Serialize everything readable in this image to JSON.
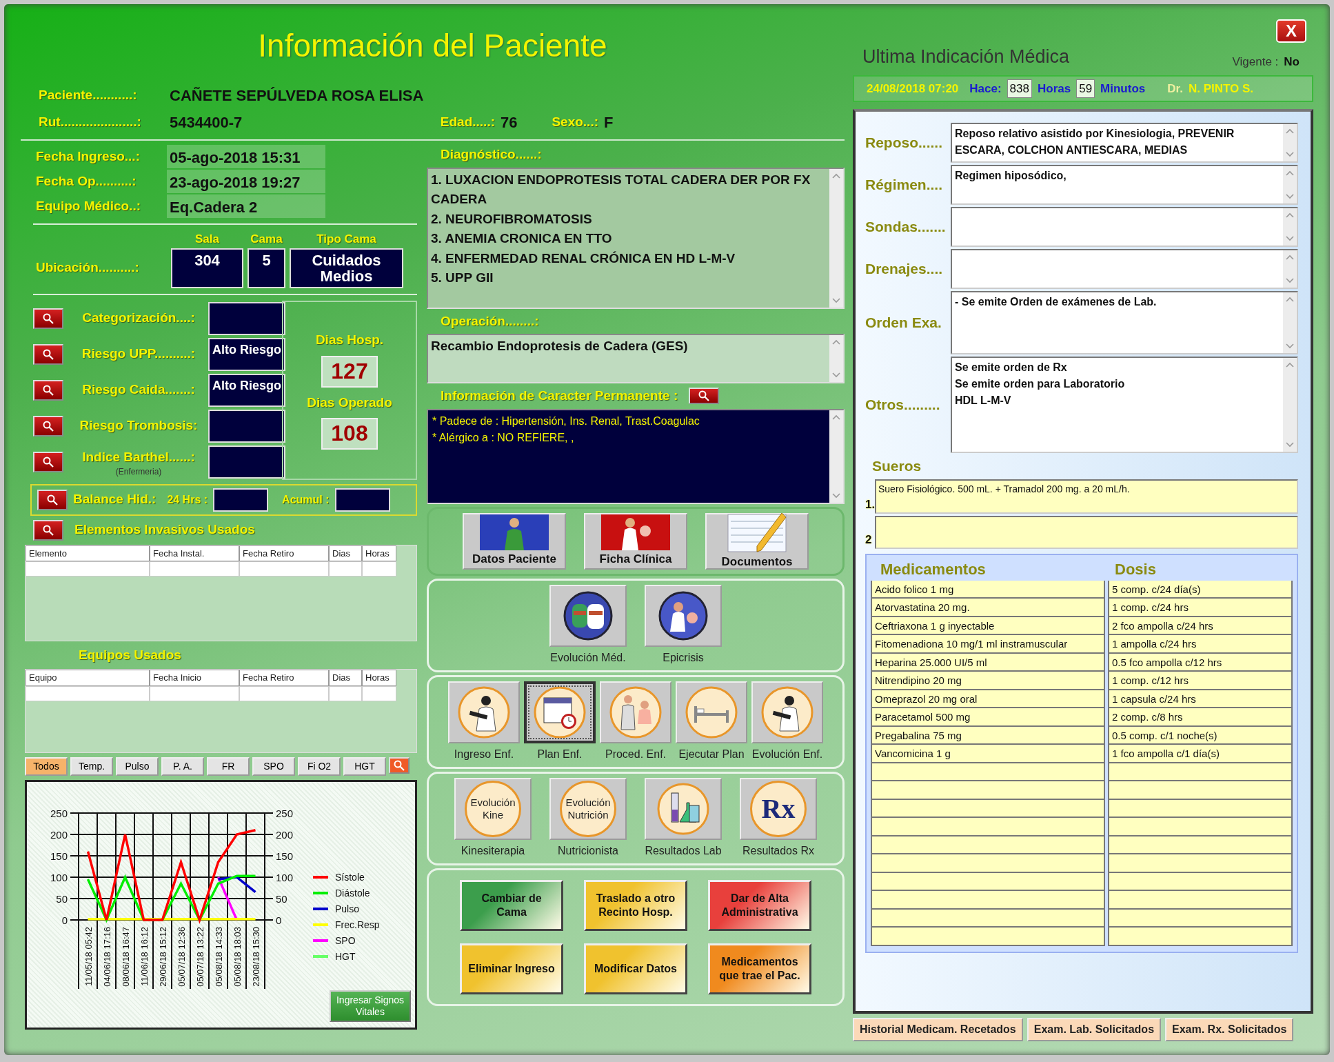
{
  "window": {
    "title": "Información del Paciente",
    "close_button": "X"
  },
  "patient": [
    {
      "label": "Paciente...........:",
      "value": "CAÑETE SEPÚLVEDA ROSA ELISA"
    },
    {
      "label": "Rut.....................:",
      "value": "5434400-7"
    }
  ],
  "age": {
    "label": "Edad.....:",
    "value": "76"
  },
  "sex": {
    "label": "Sexo...:",
    "value": "F"
  },
  "admission": [
    {
      "label": "Fecha Ingreso...:",
      "value": "05-ago-2018 15:31"
    },
    {
      "label": "Fecha Op..........:",
      "value": "23-ago-2018 19:27"
    },
    {
      "label": "Equipo Médico..:",
      "value": "Eq.Cadera 2"
    }
  ],
  "location": {
    "label": "Ubicación..........:",
    "fields": [
      {
        "label": "Sala",
        "value": "304"
      },
      {
        "label": "Cama",
        "value": "5"
      },
      {
        "label": "Tipo Cama",
        "value": "Cuidados Medios"
      }
    ]
  },
  "risks": [
    {
      "label": "Categorización....:"
    },
    {
      "label": "Riesgo UPP..........:",
      "value": "Alto Riesgo"
    },
    {
      "label": "Riesgo Caida.......:",
      "value": "Alto Riesgo"
    },
    {
      "label": "Riesgo Trombosis:"
    },
    {
      "label": "Indice Barthel......:",
      "sublabel": "(Enfermeria)"
    }
  ],
  "stay": [
    {
      "label": "Dias Hosp.",
      "value": "127"
    },
    {
      "label": "Dias Operado",
      "value": "108"
    }
  ],
  "fluid_balance": {
    "label": "Balance Hid.:",
    "fields": [
      "24 Hrs :",
      "Acumul :"
    ]
  },
  "invasive_elements": {
    "title": "Elementos Invasivos Usados",
    "columns": [
      "Elemento",
      "Fecha Instal.",
      "Fecha Retiro",
      "Dias",
      "Horas"
    ]
  },
  "equipment": {
    "title": "Equipos Usados",
    "columns": [
      "Equipo",
      "Fecha Inicio",
      "Fecha Retiro",
      "Dias",
      "Horas"
    ]
  },
  "vitals": {
    "tabs": [
      {
        "label": "Todos",
        "selected": true
      },
      {
        "label": "Temp.",
        "selected": false
      },
      {
        "label": "Pulso",
        "selected": false
      },
      {
        "label": "P. A.",
        "selected": false
      },
      {
        "label": "FR",
        "selected": false
      },
      {
        "label": "SPO",
        "selected": false
      },
      {
        "label": "Fi O2",
        "selected": false
      },
      {
        "label": "HGT",
        "selected": false
      }
    ],
    "chart_data": {
      "type": "line",
      "categories": [
        "11/05/18 05:42",
        "04/06/18 17:16",
        "08/06/18 16:47",
        "11/06/18 16:12",
        "29/06/18 15:12",
        "05/07/18 12:36",
        "05/07/18 13:22",
        "05/08/18 14:33",
        "05/08/18 18:03",
        "23/08/18 15:30"
      ],
      "ylim": [
        0,
        250
      ],
      "yticks": [
        0,
        50,
        100,
        150,
        200,
        250
      ],
      "annotations": [
        "0",
        "50",
        "100",
        "150",
        "200",
        "250"
      ],
      "grid": true,
      "legend": "right",
      "series": [
        {
          "name": "Sístole",
          "color": "#ff0000",
          "values": [
            160,
            0,
            200,
            0,
            0,
            135,
            0,
            135,
            200,
            210
          ]
        },
        {
          "name": "Diástole",
          "color": "#00ee00",
          "values": [
            95,
            0,
            100,
            0,
            0,
            85,
            0,
            85,
            103,
            103
          ]
        },
        {
          "name": "Pulso",
          "color": "#0000cc",
          "values": [
            null,
            null,
            null,
            null,
            null,
            null,
            null,
            95,
            100,
            65
          ]
        },
        {
          "name": "Frec.Resp",
          "color": "#ffff00",
          "values": [
            2,
            2,
            2,
            2,
            2,
            2,
            2,
            2,
            2,
            2
          ]
        },
        {
          "name": "SPO",
          "color": "#ff00ff",
          "values": [
            null,
            null,
            null,
            null,
            null,
            null,
            null,
            100,
            0,
            null
          ]
        },
        {
          "name": "HGT",
          "color": "#66ff66",
          "values": [
            null,
            null,
            null,
            null,
            null,
            null,
            null,
            null,
            null,
            null
          ]
        }
      ]
    },
    "button": "Ingresar Signos Vitales"
  },
  "diagnosis": {
    "label": "Diagnóstico......:",
    "lines": [
      "1. LUXACION ENDOPROTESIS TOTAL CADERA DER POR FX CADERA",
      "2. NEUROFIBROMATOSIS",
      "3. ANEMIA CRONICA EN TTO",
      "4. ENFERMEDAD RENAL CRÓNICA EN HD L-M-V",
      "5. UPP GII"
    ]
  },
  "operation": {
    "label": "Operación........:",
    "text": "Recambio Endoprotesis de Cadera (GES)"
  },
  "permanent_info": {
    "label": "Información de Caracter Permanente :",
    "lines": [
      "* Padece de : Hipertensión, Ins. Renal, Trast.Coagulac",
      "* Alérgico a : NO REFIERE, ,"
    ]
  },
  "button_groups": [
    {
      "kind": "inside",
      "buttons": [
        {
          "label": "Datos Paciente",
          "kind": "person"
        },
        {
          "label": "Ficha Clínica",
          "kind": "doctor"
        },
        {
          "label": "Documentos",
          "kind": "document"
        }
      ]
    },
    {
      "kind": "below",
      "buttons": [
        {
          "label": "Evolución Méd.",
          "kind": "doctors"
        },
        {
          "label": "Epicrisis",
          "kind": "exam"
        }
      ]
    },
    {
      "kind": "below",
      "buttons": [
        {
          "label": "Ingreso Enf.",
          "kind": "nurse",
          "focused": false
        },
        {
          "label": "Plan Enf.",
          "kind": "calendar",
          "focused": true
        },
        {
          "label": "Proced. Enf.",
          "kind": "procedure",
          "focused": false
        },
        {
          "label": "Ejecutar Plan",
          "kind": "bed",
          "focused": false
        },
        {
          "label": "Evolución Enf.",
          "kind": "nurse",
          "focused": false
        }
      ]
    },
    {
      "kind": "below",
      "buttons": [
        {
          "label": "Kinesiterapia",
          "kind": "emblem",
          "emblem": "Evolución Kine"
        },
        {
          "label": "Nutricionista",
          "kind": "emblem",
          "emblem": "Evolución Nutrición"
        },
        {
          "label": "Resultados Lab",
          "kind": "flask"
        },
        {
          "label": "Resultados Rx",
          "kind": "rx",
          "emblem": "Rx"
        }
      ]
    }
  ],
  "actions": [
    {
      "label": "Cambiar de Cama",
      "color": "#3c9e4c"
    },
    {
      "label": "Traslado a otro Recinto Hosp.",
      "color": "#f0c22e"
    },
    {
      "label": "Dar de Alta Administrativa",
      "color": "#e8403c"
    },
    {
      "label": "Eliminar Ingreso",
      "color": "#f0c22e"
    },
    {
      "label": "Modificar Datos",
      "color": "#f0c22e"
    },
    {
      "label": "Medicamentos que trae el Pac.",
      "color": "#f08a1e"
    }
  ],
  "indication": {
    "title": "Ultima Indicación Médica",
    "vigente_label": "Vigente :",
    "vigente": "No",
    "date": "24/08/2018 07:20",
    "ago_label": "Hace:",
    "hours": "838",
    "hours_label": "Horas",
    "minutes": "59",
    "minutes_label": "Minutos",
    "doctor_prefix": "Dr.",
    "doctor": "N. PINTO S.",
    "fields": [
      {
        "label": "Reposo......",
        "lines": [
          "Reposo relativo asistido por Kinesiologia,  PREVENIR ESCARA,  COLCHON ANTIESCARA,  MEDIAS"
        ]
      },
      {
        "label": "Régimen....",
        "lines": [
          "Regimen hiposódico,"
        ]
      },
      {
        "label": "Sondas......."
      },
      {
        "label": "Drenajes...."
      },
      {
        "label": "Orden Exa.",
        "lines": [
          "- Se emite Orden de exámenes de Lab."
        ]
      },
      {
        "label": "Otros.........",
        "lines": [
          "Se emite orden de Rx",
          "Se emite orden para Laboratorio",
          "HDL L-M-V"
        ]
      }
    ],
    "serums_title": "Sueros",
    "serums": [
      {
        "number": "1.",
        "text": "Suero Fisiológico. 500 mL. + Tramadol 200 mg. a 20 mL/h."
      },
      {
        "number": "2"
      }
    ],
    "med_columns": [
      "Medicamentos",
      "Dosis"
    ],
    "medications": [
      {
        "name": "Acido folico 1 mg",
        "dose": "5 comp. c/24 día(s)"
      },
      {
        "name": "Atorvastatina 20 mg.",
        "dose": "1 comp. c/24 hrs"
      },
      {
        "name": "Ceftriaxona 1 g inyectable",
        "dose": "2 fco ampolla c/24 hrs"
      },
      {
        "name": "Fitomenadiona 10 mg/1 ml instramuscular",
        "dose": "1 ampolla c/24 hrs"
      },
      {
        "name": "Heparina 25.000 UI/5 ml",
        "dose": "0.5 fco ampolla c/12 hrs"
      },
      {
        "name": "Nitrendipino 20 mg",
        "dose": "1 comp. c/12 hrs"
      },
      {
        "name": "Omeprazol 20 mg oral",
        "dose": "1 capsula c/24 hrs"
      },
      {
        "name": "Paracetamol 500 mg",
        "dose": "2 comp. c/8 hrs"
      },
      {
        "name": "Pregabalina 75 mg",
        "dose": "0.5 comp. c/1 noche(s)"
      },
      {
        "name": "Vancomicina 1 g",
        "dose": "1 fco ampolla c/1 día(s)"
      }
    ]
  },
  "bottom_tabs": [
    "Historial Medicam. Recetados",
    "Exam. Lab. Solicitados",
    "Exam. Rx. Solicitados"
  ]
}
